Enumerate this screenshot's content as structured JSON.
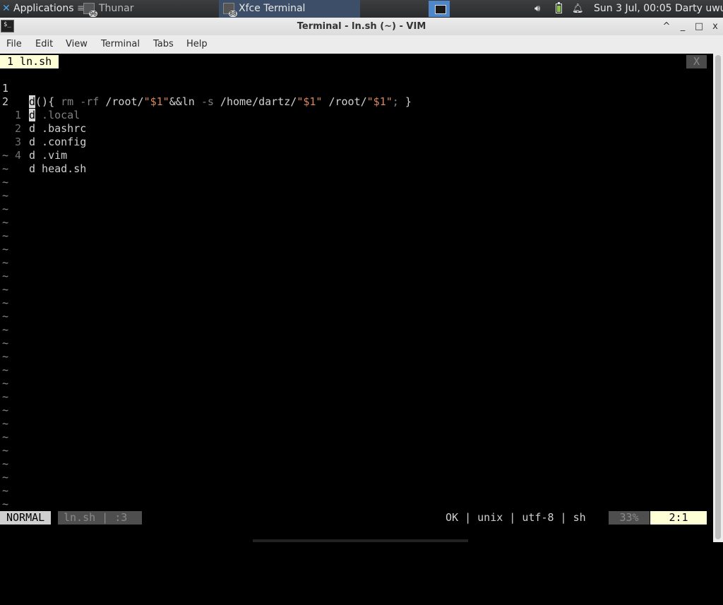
{
  "panel": {
    "applications_label": "Applications",
    "tasks": [
      {
        "label": "Thunar",
        "badge": "96"
      },
      {
        "label": "Xfce Terminal",
        "badge": "88"
      }
    ],
    "clock": "Sun  3 Jul, 00:05",
    "user": "Darty uwu",
    "icons": {
      "volume": "volume-icon",
      "battery": "battery-icon",
      "notifications": "bell-icon"
    }
  },
  "window": {
    "title": "Terminal - ln.sh (~) - VIM",
    "controls": [
      "^",
      "_",
      "□",
      "x"
    ]
  },
  "menubar": [
    "File",
    "Edit",
    "View",
    "Terminal",
    "Tabs",
    "Help"
  ],
  "vim": {
    "tab_label": "1 ln.sh",
    "tab_close": "X",
    "lines": [
      {
        "num": "1",
        "cursor": "d",
        "rest_a": "(){ ",
        "dim_a": "rm -rf",
        "rest_b": " /root/",
        "str_a": "\"$1\"",
        "rest_c": "&&ln ",
        "dim_b": "-s",
        "rest_d": " /home/dartz/",
        "str_b": "\"$1\"",
        "rest_e": " /root/",
        "str_c": "\"$1\"",
        "dim_c": ";",
        "rest_f": " }"
      },
      {
        "num": "2",
        "cursor": "d",
        "text": " .local"
      },
      {
        "num": "1",
        "text": "d .bashrc"
      },
      {
        "num": "2",
        "text": "d .config"
      },
      {
        "num": "3",
        "text": "d .vim"
      },
      {
        "num": "4",
        "text": "d head.sh"
      }
    ],
    "tilde": "~",
    "status": {
      "mode": "NORMAL",
      "file": "ln.sh | :3",
      "info": "OK | unix | utf-8 | sh",
      "percent": "33%",
      "position": "2:1"
    }
  }
}
